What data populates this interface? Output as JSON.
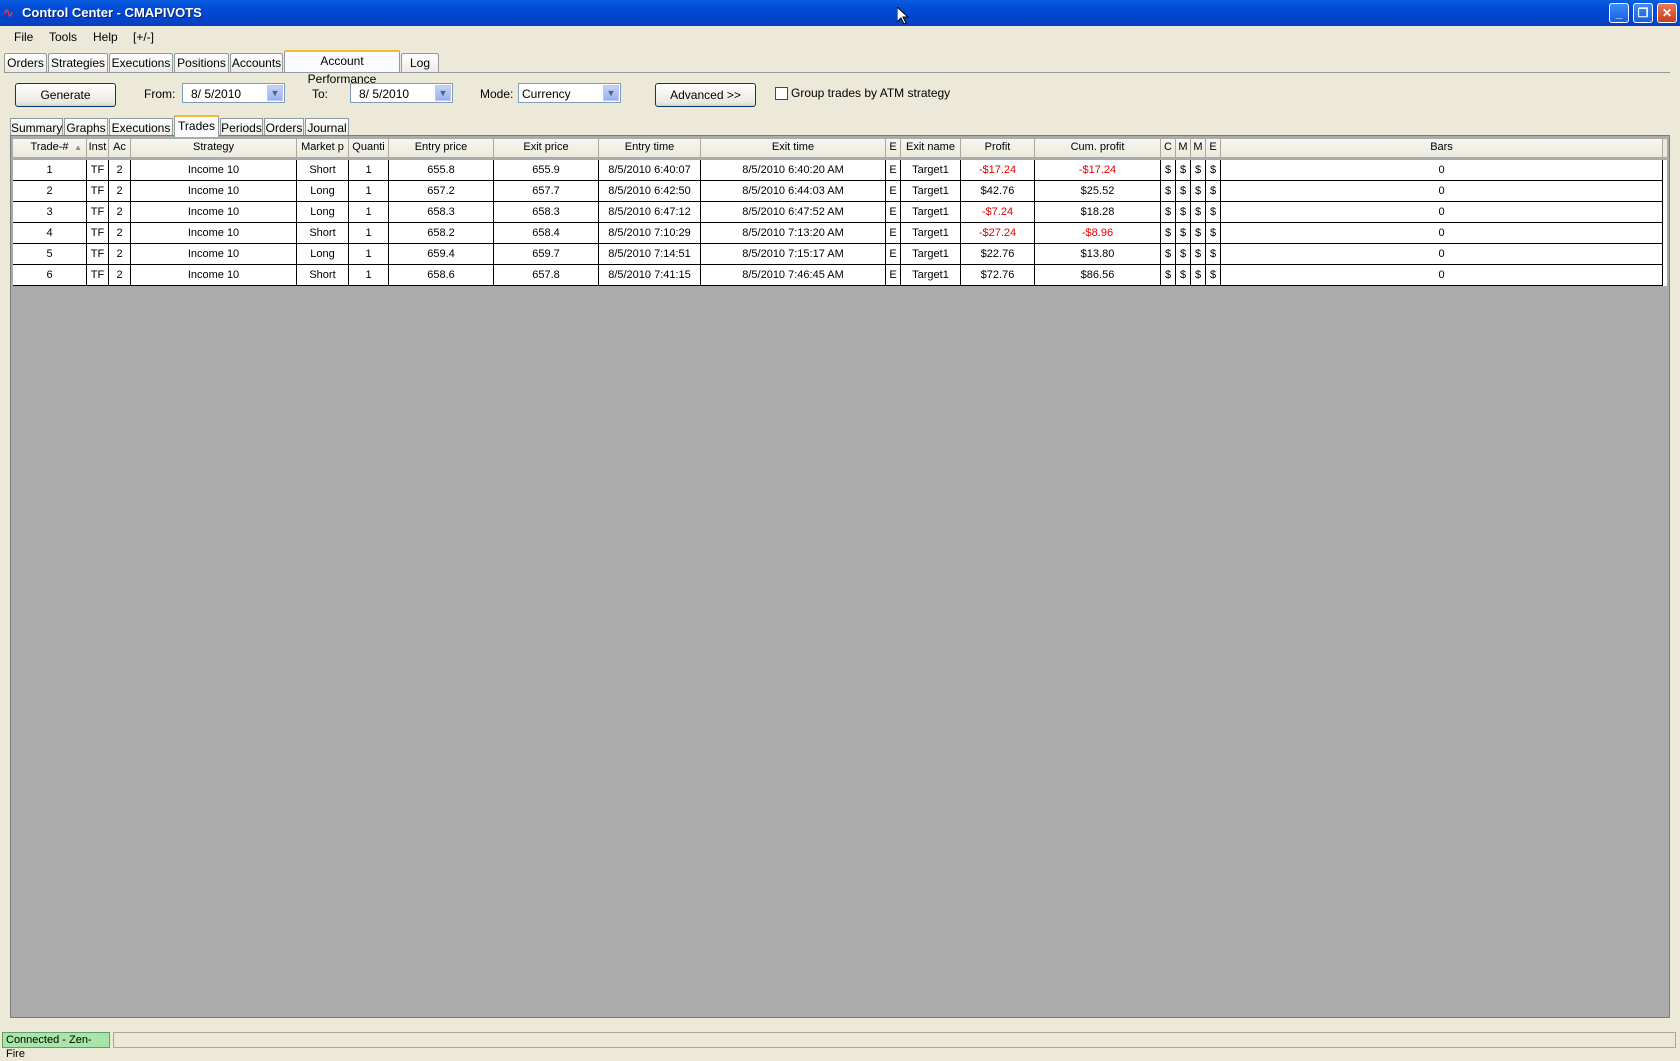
{
  "window": {
    "title": "Control Center - CMAPIVOTS",
    "min": "_",
    "max": "❐",
    "close": "✕"
  },
  "menu": {
    "items": [
      "File",
      "Tools",
      "Help",
      "[+/-]"
    ]
  },
  "tabs": {
    "items": [
      "Orders",
      "Strategies",
      "Executions",
      "Positions",
      "Accounts",
      "Account Performance",
      "Log"
    ],
    "active": "Account Performance"
  },
  "toolbar": {
    "generate_label": "Generate",
    "from_label": "From:",
    "from_value": "8/ 5/2010",
    "to_label": "To:",
    "to_value": "8/ 5/2010",
    "mode_label": "Mode:",
    "mode_value": "Currency",
    "advanced_label": "Advanced >>",
    "group_label": "Group trades by ATM strategy",
    "group_checked": false
  },
  "subtabs": {
    "items": [
      "Summary",
      "Graphs",
      "Executions",
      "Trades",
      "Periods",
      "Orders",
      "Journal"
    ],
    "active": "Trades"
  },
  "grid": {
    "columns": [
      "Trade-#",
      "Inst",
      "Ac",
      "Strategy",
      "Market p",
      "Quanti",
      "Entry price",
      "Exit price",
      "Entry time",
      "Exit time",
      "E",
      "Exit name",
      "Profit",
      "Cum. profit",
      "C",
      "M",
      "M",
      "E",
      "Bars"
    ],
    "rows": [
      [
        "1",
        "TF",
        "2",
        "Income 10",
        "Short",
        "1",
        "655.8",
        "655.9",
        "8/5/2010 6:40:07",
        "8/5/2010 6:40:20 AM",
        "E",
        "Target1",
        "-$17.24",
        "-$17.24",
        "$",
        "$",
        "$",
        "$",
        "0"
      ],
      [
        "2",
        "TF",
        "2",
        "Income 10",
        "Long",
        "1",
        "657.2",
        "657.7",
        "8/5/2010 6:42:50",
        "8/5/2010 6:44:03 AM",
        "E",
        "Target1",
        "$42.76",
        "$25.52",
        "$",
        "$",
        "$",
        "$",
        "0"
      ],
      [
        "3",
        "TF",
        "2",
        "Income 10",
        "Long",
        "1",
        "658.3",
        "658.3",
        "8/5/2010 6:47:12",
        "8/5/2010 6:47:52 AM",
        "E",
        "Target1",
        "-$7.24",
        "$18.28",
        "$",
        "$",
        "$",
        "$",
        "0"
      ],
      [
        "4",
        "TF",
        "2",
        "Income 10",
        "Short",
        "1",
        "658.2",
        "658.4",
        "8/5/2010 7:10:29",
        "8/5/2010 7:13:20 AM",
        "E",
        "Target1",
        "-$27.24",
        "-$8.96",
        "$",
        "$",
        "$",
        "$",
        "0"
      ],
      [
        "5",
        "TF",
        "2",
        "Income 10",
        "Long",
        "1",
        "659.4",
        "659.7",
        "8/5/2010 7:14:51",
        "8/5/2010 7:15:17 AM",
        "E",
        "Target1",
        "$22.76",
        "$13.80",
        "$",
        "$",
        "$",
        "$",
        "0"
      ],
      [
        "6",
        "TF",
        "2",
        "Income 10",
        "Short",
        "1",
        "658.6",
        "657.8",
        "8/5/2010 7:41:15",
        "8/5/2010 7:46:45 AM",
        "E",
        "Target1",
        "$72.76",
        "$86.56",
        "$",
        "$",
        "$",
        "$",
        "0"
      ]
    ],
    "negative_color": "#e00000"
  },
  "statusbar": {
    "connection": "Connected - Zen-Fire",
    "connection_color": "#a6e6a6"
  }
}
